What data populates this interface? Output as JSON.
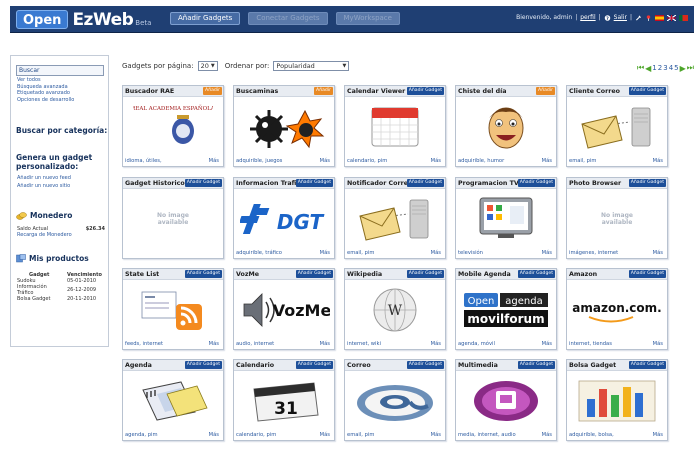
{
  "header": {
    "brand_open": "Open",
    "brand_ez": "EzWeb",
    "brand_beta": "Beta",
    "tabs": [
      "Añadir Gadgets",
      "Conectar Gadgets",
      "MyWorkspace"
    ],
    "user_greeting": "Bienvenido, admin",
    "profile_link": "perfil",
    "logout_link": "Salir"
  },
  "sidebar": {
    "search_value": "Buscar",
    "search_links": [
      "Ver todos",
      "Búsqueda avanzada",
      "Etiquetado avanzado",
      "Opciones de desarrollo"
    ],
    "category_heading": "Buscar por categoría:",
    "create_heading": "Genera un gadget personalizado:",
    "create_links": [
      "Añadir un nuevo feed",
      "Añadir un nuevo sitio"
    ],
    "wallet_heading": "Monedero",
    "balance_label": "Saldo Actual",
    "balance_value": "$26.34",
    "recharge_link": "Recarga de Monedero",
    "products_heading": "Mis productos",
    "products_columns": [
      "Gadget",
      "Vencimiento"
    ],
    "products": [
      {
        "name": "Sudoku",
        "date": "05-01-2010"
      },
      {
        "name": "Información Tráfico",
        "date": "26-12-2009"
      },
      {
        "name": "Bolsa Gadget",
        "date": "20-11-2010"
      }
    ]
  },
  "controls": {
    "per_page_label": "Gadgets por página:",
    "per_page_value": "20",
    "order_label": "Ordenar por:",
    "order_value": "Popularidad",
    "pages": [
      "1",
      "2",
      "3",
      "4",
      "5"
    ]
  },
  "gadgets": [
    {
      "title": "Buscador RAE",
      "btn": "Añadir",
      "btn_style": "orange",
      "tags": "idioma, útiles,",
      "more": "Más",
      "icon": "rae-crest-icon",
      "img_text": "REAL ACADEMIA ESPAÑOLA"
    },
    {
      "title": "Buscaminas",
      "btn": "Añadir",
      "btn_style": "orange",
      "tags": "adquirible, juegos",
      "more": "Más",
      "icon": "mine-icon"
    },
    {
      "title": "Calendar Viewer",
      "btn": "Añadir Gadget",
      "btn_style": "blue",
      "tags": "calendario, pim",
      "more": "Más",
      "icon": "calendar-icon"
    },
    {
      "title": "Chiste del día",
      "btn": "Añadir",
      "btn_style": "orange",
      "tags": "adquirible, humor",
      "more": "Más",
      "icon": "smiley-face-icon"
    },
    {
      "title": "Cliente Correo",
      "btn": "Añadir Gadget",
      "btn_style": "blue",
      "tags": "email, pim",
      "more": "Más",
      "icon": "mail-server-icon"
    },
    {
      "title": "Gadget Historico",
      "btn": "Añadir Gadget",
      "btn_style": "blue",
      "tags": "",
      "more": "",
      "icon": "no-image-icon",
      "img_text": "No image available"
    },
    {
      "title": "Informacion Trafico",
      "btn": "Añadir Gadget",
      "btn_style": "blue",
      "tags": "adquirible, tráfico",
      "more": "Más",
      "icon": "dgt-logo-icon",
      "img_text": "DGT"
    },
    {
      "title": "Notificador Correo",
      "btn": "Añadir Gadget",
      "btn_style": "blue",
      "tags": "email, pim",
      "more": "Más",
      "icon": "mail-server-icon"
    },
    {
      "title": "Programacion TV",
      "btn": "Añadir Gadget",
      "btn_style": "blue",
      "tags": "televisión",
      "more": "Más",
      "icon": "tv-icon"
    },
    {
      "title": "Photo Browser",
      "btn": "Añadir Gadget",
      "btn_style": "blue",
      "tags": "imágenes, internet",
      "more": "Más",
      "icon": "no-image-icon",
      "img_text": "No image available"
    },
    {
      "title": "State List",
      "btn": "Añadir Gadget",
      "btn_style": "blue",
      "tags": "feeds, internet",
      "more": "Más",
      "icon": "rss-feed-icon"
    },
    {
      "title": "VozMe",
      "btn": "Añadir Gadget",
      "btn_style": "blue",
      "tags": "audio, internet",
      "more": "Más",
      "icon": "speaker-icon",
      "img_text": "VozMe"
    },
    {
      "title": "Wikipedia",
      "btn": "Añadir Gadget",
      "btn_style": "blue",
      "tags": "internet, wiki",
      "more": "Más",
      "icon": "wikipedia-globe-icon"
    },
    {
      "title": "Mobile Agenda",
      "btn": "Añadir Gadget",
      "btn_style": "blue",
      "tags": "agenda, móvil",
      "more": "Más",
      "icon": "openagenda-logo-icon",
      "img_text": "Open agenda movilforum"
    },
    {
      "title": "Amazon",
      "btn": "Añadir Gadget",
      "btn_style": "blue",
      "tags": "internet, tiendas",
      "more": "Más",
      "icon": "amazon-logo-icon",
      "img_text": "amazon.com."
    },
    {
      "title": "Agenda",
      "btn": "Añadir Gadget",
      "btn_style": "blue",
      "tags": "agenda, pim",
      "more": "Más",
      "icon": "agenda-book-icon"
    },
    {
      "title": "Calendario",
      "btn": "Añadir Gadget",
      "btn_style": "blue",
      "tags": "calendario, pim",
      "more": "Más",
      "icon": "calendar-31-icon",
      "img_text": "31"
    },
    {
      "title": "Correo",
      "btn": "Añadir Gadget",
      "btn_style": "blue",
      "tags": "email, pim",
      "more": "Más",
      "icon": "at-sign-icon"
    },
    {
      "title": "Multimedia",
      "btn": "Añadir Gadget",
      "btn_style": "blue",
      "tags": "media, internet, audio",
      "more": "Más",
      "icon": "multimedia-icon"
    },
    {
      "title": "Bolsa Gadget",
      "btn": "Añadir Gadget",
      "btn_style": "blue",
      "tags": "adquirible, bolsa,",
      "more": "Más",
      "icon": "bar-chart-icon"
    }
  ]
}
